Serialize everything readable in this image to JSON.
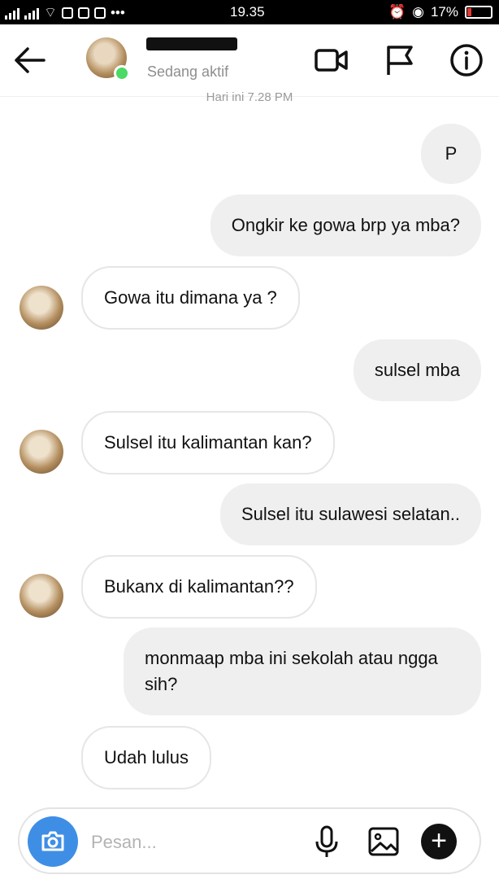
{
  "status_bar": {
    "time": "19.35",
    "battery": "17%"
  },
  "header": {
    "status": "Sedang aktif",
    "icons": [
      "back-arrow-icon",
      "video-call-icon",
      "flag-icon",
      "info-icon"
    ]
  },
  "chat": {
    "timestamp": "Hari ini 7.28 PM",
    "messages": [
      {
        "from": "me",
        "text": "P"
      },
      {
        "from": "me",
        "text": "Ongkir ke gowa brp ya mba?"
      },
      {
        "from": "them",
        "text": "Gowa itu dimana ya ?"
      },
      {
        "from": "me",
        "text": "sulsel mba"
      },
      {
        "from": "them",
        "text": "Sulsel itu kalimantan kan?"
      },
      {
        "from": "me",
        "text": "Sulsel itu sulawesi selatan.."
      },
      {
        "from": "them",
        "text": "Bukanx di kalimantan??"
      },
      {
        "from": "me",
        "text": "monmaap mba ini sekolah atau ngga sih?"
      },
      {
        "from": "them",
        "text": "Udah lulus"
      }
    ]
  },
  "composer": {
    "placeholder": "Pesan...",
    "icons": [
      "camera-icon",
      "microphone-icon",
      "gallery-icon",
      "plus-icon"
    ]
  },
  "colors": {
    "accent_blue": "#3f8ee6",
    "outgoing_bubble": "#efefef",
    "online_green": "#4cd964"
  }
}
